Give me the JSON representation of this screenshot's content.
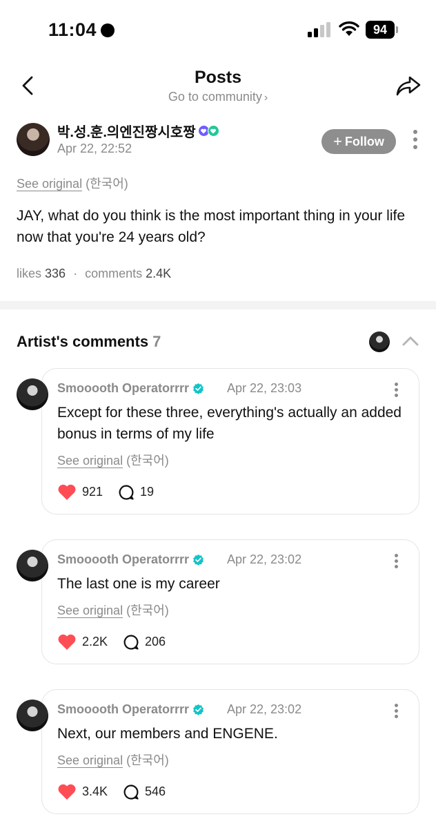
{
  "status_bar": {
    "time": "11:04",
    "battery": "94"
  },
  "header": {
    "title": "Posts",
    "subtitle": "Go to community",
    "subtitle_chevron": "›"
  },
  "post": {
    "author": "박.성.훈.의엔진짱시호짱",
    "date": "Apr 22, 22:52",
    "follow_label": "Follow",
    "follow_plus": "+",
    "see_original": "See original",
    "language": "(한국어)",
    "body": "JAY, what do you think is the most important thing in your life now that you're 24 years old?",
    "likes_label": "likes",
    "likes": "336",
    "comments_label": "comments",
    "comments": "2.4K",
    "separator": "·"
  },
  "artist_comments": {
    "title": "Artist's comments",
    "count": "7",
    "items": [
      {
        "name": "Smooooth Operatorrrr",
        "date": "Apr 22, 23:03",
        "text": "Except for these three, everything's actually an added bonus in terms of my life",
        "see_original": "See original",
        "language": "(한국어)",
        "likes": "921",
        "replies": "19"
      },
      {
        "name": "Smooooth Operatorrrr",
        "date": "Apr 22, 23:02",
        "text": "The last one is my career",
        "see_original": "See original",
        "language": "(한국어)",
        "likes": "2.2K",
        "replies": "206"
      },
      {
        "name": "Smooooth Operatorrrr",
        "date": "Apr 22, 23:02",
        "text": "Next, our members and ENGENE.",
        "see_original": "See original",
        "language": "(한국어)",
        "likes": "3.4K",
        "replies": "546"
      }
    ]
  },
  "colors": {
    "heart": "#ff4d55",
    "verified": "#12c4c7",
    "follow_bg": "#8e8e8e",
    "muted_text": "#8a8a8a"
  },
  "icons": [
    "back-arrow-icon",
    "share-icon",
    "more-vertical-icon",
    "verified-icon",
    "heart-icon",
    "comment-bubble-icon",
    "chevron-up-icon",
    "cellular-signal-icon",
    "wifi-icon",
    "battery-icon"
  ]
}
